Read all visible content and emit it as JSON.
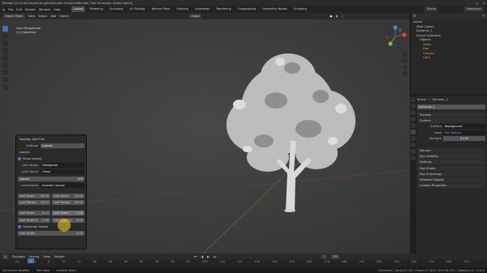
{
  "titlebar": {
    "title": "Blender [D:\\Outlines\\article.cgbin\\Blender Practical\\Blender Tree Generator Addon.blend]"
  },
  "menubar": {
    "menus": [
      "File",
      "Edit",
      "Render",
      "Window",
      "Help"
    ],
    "tabs": [
      "Layout",
      "Modeling",
      "Sculpting",
      "UV Editing",
      "Texture Paint",
      "Shading",
      "Animation",
      "Rendering",
      "Compositing",
      "Geometry Nodes",
      "Scripting"
    ],
    "active_tab": "Layout",
    "scene": "Scene",
    "view_layer": "ViewLayer"
  },
  "viewport_header": {
    "mode": "Object Mode",
    "menus": [
      "View",
      "Select",
      "Add",
      "Object"
    ],
    "orientation": "Global",
    "options": "Options"
  },
  "viewport_overlay": {
    "line1": "User Perspective",
    "line2": "(1) Collection"
  },
  "operator_panel": {
    "title": "Sapling: Add Tree",
    "settings_label": "Settings",
    "settings_value": "Leaves",
    "leaves_section": "Leaves",
    "show_leaves": "Show Leaves",
    "leaf_shape_label": "Leaf Shape",
    "leaf_shape_value": "Hexagonal",
    "leaf_object_label": "Leaf Object",
    "leaf_object_value": "Grass",
    "leaves_label": "Leaves",
    "leaves_value": "100",
    "leaf_distrib_label": "Leaf Distrib",
    "leaf_distrib_value": "Inverse Conical",
    "down_angle": {
      "label": "Leaf Down",
      "a": "30.00",
      "b": "10.00"
    },
    "rotate": {
      "label": "Leaf Rotate",
      "a": "137.5",
      "b": "15.00"
    },
    "scale": {
      "label": "Leaf Scale",
      "a": "0.17",
      "b": "1.00"
    },
    "scale_x": {
      "label": "Leaf Scale X",
      "a": "1.00",
      "b": "0.00"
    },
    "horizontal_leaves": "Horizontal leaves",
    "leaf_angle": {
      "label": "Leaf Angle",
      "value": "0.00"
    }
  },
  "timeline": {
    "menus": [
      "Playback",
      "Keying",
      "View",
      "Marker"
    ],
    "current_frame": "1",
    "ticks": [
      "-20",
      "-10",
      "0",
      "10",
      "20",
      "30",
      "40",
      "50",
      "60",
      "70",
      "80",
      "90",
      "100",
      "110",
      "120",
      "130",
      "140",
      "150",
      "160",
      "170",
      "180",
      "190",
      "200",
      "210",
      "220",
      "230",
      "240",
      "250"
    ],
    "start": "1",
    "end": "250"
  },
  "statusbar": {
    "items": [
      "Set Active Modifier",
      "Pan View",
      "Context Menu"
    ],
    "right": "Collection | Verts:23,152 | Faces:17,421 | Tris:33,152 | Objects:1/1 | 3.4.0"
  },
  "outliner": {
    "items": [
      "Scene",
      "View Layers",
      "Dynamic_1",
      "Scene Collection",
      "Objects",
      "Grass",
      "tree",
      "Camera",
      "Light"
    ]
  },
  "properties": {
    "header_scene": "Scene",
    "header_world": "Dynamic_1",
    "world_field": "Dynamic_1",
    "sections": [
      "Preview",
      "Surface"
    ],
    "surface_label": "Surface",
    "surface_value": "Background",
    "color_label": "Color",
    "color_value": "Sky Texture",
    "strength_label": "Strength",
    "strength_value": "0.130",
    "bottom_sections": [
      "Volume",
      "Ray Visibility",
      "Settings",
      "Gas Studio",
      "Ray Anisotropy",
      "Viewport Display",
      "Custom Properties"
    ]
  },
  "colors": {
    "accent": "#4772b3",
    "viewport_bg": "#3d3d3d",
    "panel_bg": "#282828",
    "highlight": "#e6c828"
  }
}
